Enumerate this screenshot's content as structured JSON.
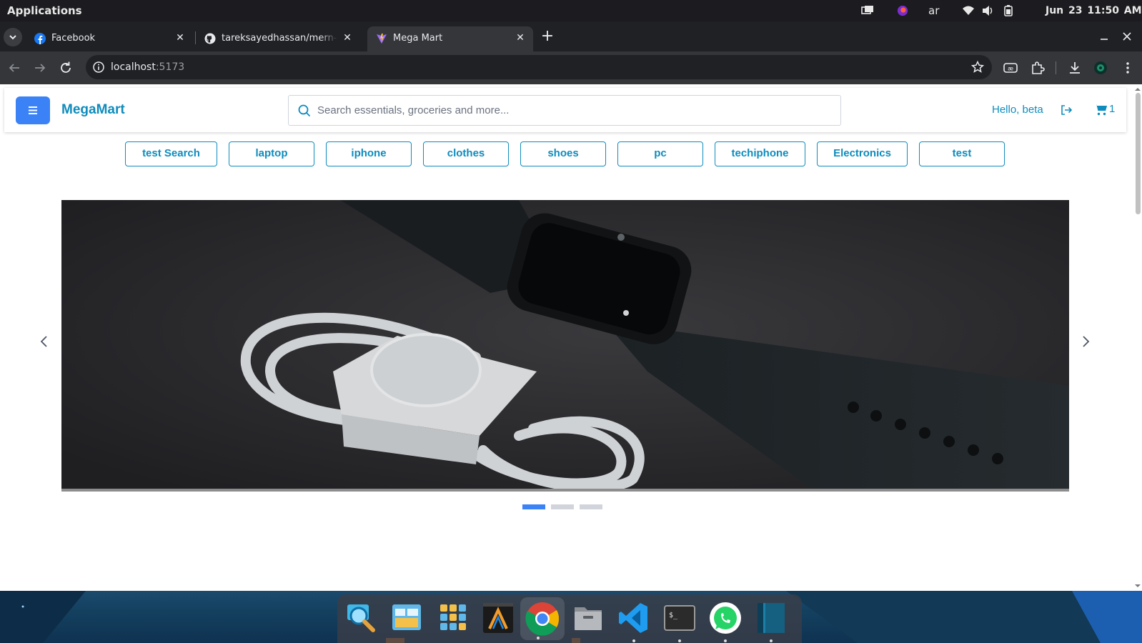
{
  "os_bar": {
    "applications_label": "Applications",
    "keyboard_layout": "ar",
    "datetime": "Jun 23  11:50 AM"
  },
  "tabs": [
    {
      "title": "Facebook",
      "icon": "facebook-icon",
      "active": false
    },
    {
      "title": "tareksayedhassan/mern-sta",
      "icon": "github-icon",
      "active": false
    },
    {
      "title": "Mega Mart",
      "icon": "vite-icon",
      "active": true
    }
  ],
  "address_bar": {
    "host": "localhost",
    "port": ":5173"
  },
  "header": {
    "brand": "MegaMart",
    "search_placeholder": "Search essentials, groceries and more...",
    "greeting": "Hello, beta",
    "cart_count": "1"
  },
  "categories": [
    "test Search",
    "laptop",
    "iphone",
    "clothes",
    "shoes",
    "pc",
    "techiphone",
    "Electronics",
    "test"
  ],
  "carousel": {
    "slide_count": 3,
    "active_index": 0,
    "image": "smartwatch-with-charging-cable"
  },
  "dock": {
    "apps": [
      "search-app",
      "files-manager",
      "app-grid",
      "code-editor",
      "chrome",
      "file-cabinet",
      "vscode",
      "terminal",
      "whatsapp",
      "sidebar-app"
    ]
  },
  "colors": {
    "brand": "#0e8cbd",
    "menu_button": "#3b82f6",
    "chrome_dark": "#202124",
    "chrome_toolbar": "#35363a"
  }
}
